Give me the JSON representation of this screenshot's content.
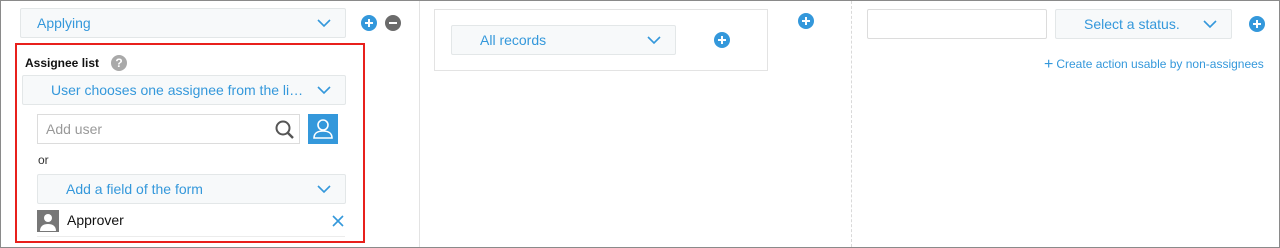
{
  "column1": {
    "status_dropdown": {
      "label": "Applying"
    },
    "assignee": {
      "section_label": "Assignee list",
      "help_icon": "?",
      "mode_dropdown": {
        "label": "User chooses one assignee from the list t..."
      },
      "add_user_input": {
        "placeholder": "Add user",
        "value": ""
      },
      "or_label": "or",
      "field_dropdown": {
        "label": "Add a field of the form"
      },
      "selected_assignees": [
        {
          "label": "Approver"
        }
      ]
    }
  },
  "column2": {
    "condition_dropdown": {
      "label": "All records"
    }
  },
  "column3": {
    "action_name_input": {
      "placeholder": "",
      "value": ""
    },
    "status_dropdown": {
      "label": "Select a status."
    },
    "create_action_link": {
      "label": "Create action usable by non-assignees"
    }
  },
  "icons": {
    "add": "plus-circle-icon",
    "remove": "minus-circle-icon",
    "chevron": "chevron-down-icon",
    "search": "search-icon",
    "user_picker": "user-icon",
    "avatar": "user-avatar-icon",
    "close": "close-icon"
  },
  "colors": {
    "accent": "#3498db",
    "highlight_border": "#e8201c",
    "grey_button": "#6b6b6b"
  }
}
